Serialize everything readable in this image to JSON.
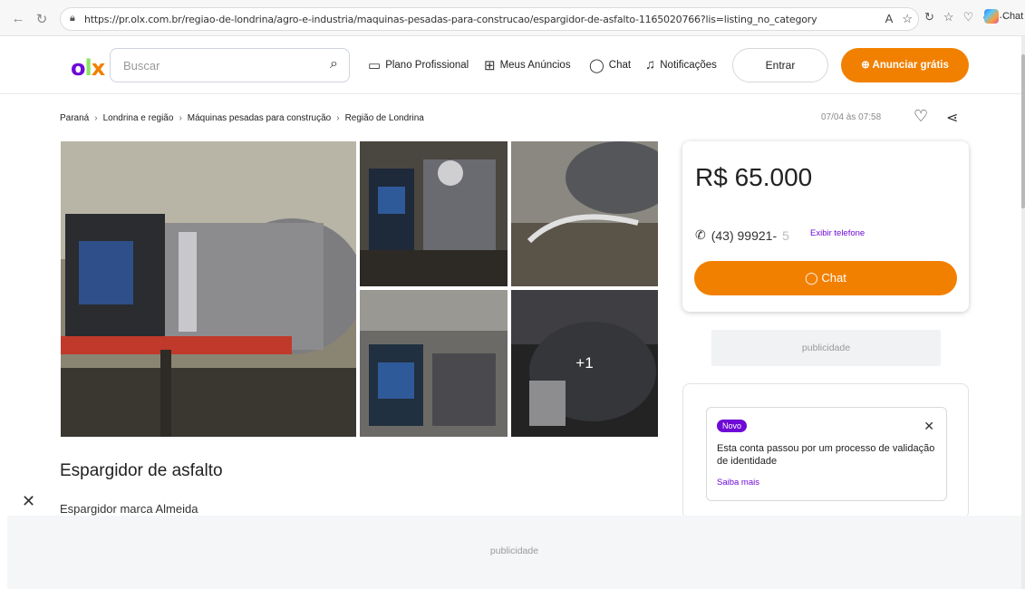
{
  "browser": {
    "url": "https://pr.olx.com.br/regiao-de-londrina/agro-e-industria/maquinas-pesadas-para-construcao/espargidor-de-asfalto-1165020766?lis=listing_no_category",
    "copilot_label": "Chat"
  },
  "header": {
    "logo": {
      "o": "o",
      "l": "l",
      "x": "x"
    },
    "search_placeholder": "Buscar",
    "nav": [
      {
        "label": "Plano Profissional",
        "icon": "briefcase-icon"
      },
      {
        "label": "Meus Anúncios",
        "icon": "grid-icon"
      },
      {
        "label": "Chat",
        "icon": "chat-icon"
      },
      {
        "label": "Notificações",
        "icon": "bell-icon"
      }
    ],
    "login_label": "Entrar",
    "announce_label": "Anunciar grátis"
  },
  "breadcrumb": [
    "Paraná",
    "Londrina e região",
    "Máquinas pesadas para construção",
    "Região de Londrina"
  ],
  "posted": "07/04 às 07:58",
  "gallery": {
    "more_label": "+1"
  },
  "listing": {
    "title": "Espargidor de asfalto",
    "description": "Espargidor marca Almeida"
  },
  "price_card": {
    "price": "R$ 65.000",
    "phone_visible": "(43) 99921-",
    "phone_faded": "5",
    "show_phone_label": "Exibir telefone",
    "chat_label": "Chat"
  },
  "ads": {
    "label": "publicidade"
  },
  "info_card": {
    "badge": "Novo",
    "text": "Esta conta passou por um processo de validação de identidade",
    "link": "Saiba mais"
  },
  "colors": {
    "brand_purple": "#6e0ad6",
    "brand_orange": "#f28000",
    "brand_green": "#8ce563"
  }
}
